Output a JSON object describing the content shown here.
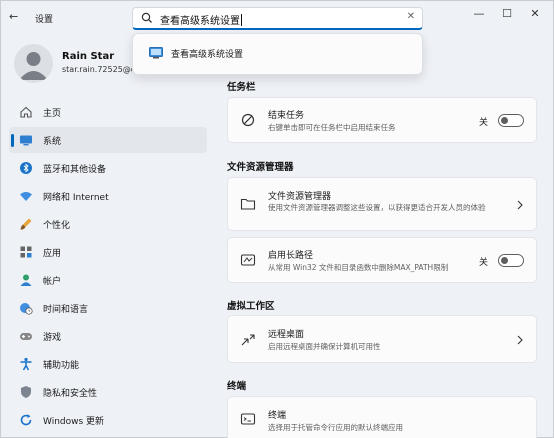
{
  "window": {
    "title": "设置"
  },
  "search": {
    "query": "查看高级系统设置",
    "suggestion": "查看高级系统设置"
  },
  "profile": {
    "name": "Rain Star",
    "email": "star.rain.72525@ou"
  },
  "nav": [
    {
      "label": "主页",
      "icon": "home-icon"
    },
    {
      "label": "系统",
      "icon": "system-icon",
      "active": true
    },
    {
      "label": "蓝牙和其他设备",
      "icon": "bluetooth-icon"
    },
    {
      "label": "网络和 Internet",
      "icon": "wifi-icon"
    },
    {
      "label": "个性化",
      "icon": "brush-icon"
    },
    {
      "label": "应用",
      "icon": "apps-icon"
    },
    {
      "label": "帐户",
      "icon": "account-icon"
    },
    {
      "label": "时间和语言",
      "icon": "globe-clock-icon"
    },
    {
      "label": "游戏",
      "icon": "gamepad-icon"
    },
    {
      "label": "辅助功能",
      "icon": "accessibility-icon"
    },
    {
      "label": "隐私和安全性",
      "icon": "shield-icon"
    },
    {
      "label": "Windows 更新",
      "icon": "update-icon"
    }
  ],
  "sections": {
    "taskbar": {
      "title": "任务栏",
      "end_task": {
        "title": "结束任务",
        "desc": "右键单击即可在任务栏中启用结束任务",
        "state": "关"
      }
    },
    "explorer": {
      "title": "文件资源管理器",
      "file_explorer": {
        "title": "文件资源管理器",
        "desc": "使用文件资源管理器调整这些设置，以获得更适合开发人员的体验"
      },
      "long_paths": {
        "title": "启用长路径",
        "desc": "从常用 Win32 文件和目录函数中删除MAX_PATH限制",
        "state": "关"
      }
    },
    "virtual_desktop": {
      "title": "虚拟工作区",
      "remote_desktop": {
        "title": "远程桌面",
        "desc": "启用远程桌面并确保计算机可用性"
      }
    },
    "terminal": {
      "title": "终端",
      "terminal": {
        "title": "终端",
        "desc": "选择用于托管命令行应用的默认终端应用"
      }
    }
  },
  "colors": {
    "accent": "#0067c0",
    "window_bg": "#eef1f6",
    "card_bg": "#fbfbfc"
  }
}
